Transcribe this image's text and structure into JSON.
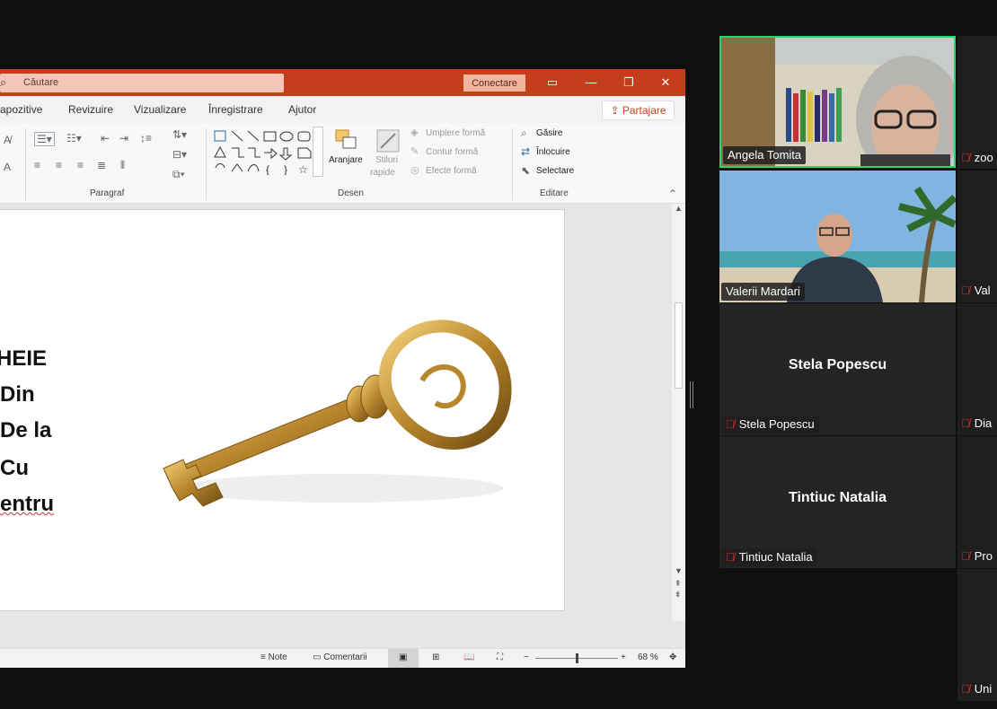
{
  "ppt": {
    "search_text": "Căutare",
    "connect_label": "Conectare",
    "tabs": [
      "apozitive",
      "Revizuire",
      "Vizualizare",
      "Înregistrare",
      "Ajutor"
    ],
    "share_label": "Partajare",
    "ribbon": {
      "group_paragraf": "Paragraf",
      "group_desen": "Desen",
      "group_editare": "Editare",
      "aranjare": "Aranjare",
      "stiluri": "Stiluri",
      "rapide": "rapide",
      "umplere_forma": "Umplere formă",
      "contur_forma": "Contur formă",
      "efecte_forma": "Efecte formă",
      "gasire": "Găsire",
      "inlocuire": "Înlocuire",
      "selectare": "Selectare"
    },
    "slide_lines": [
      "HEIE",
      "Din",
      "De la",
      "Cu",
      "entru"
    ],
    "status": {
      "note": "Note",
      "comentarii": "Comentarii",
      "zoom": "68 %",
      "zoom_fraction": 0.5
    }
  },
  "participants": [
    {
      "name": "Angela Tomita",
      "has_video": true,
      "speaking": true
    },
    {
      "name": "Valerii Mardari",
      "has_video": true,
      "speaking": false
    },
    {
      "name": "Stela Popescu",
      "has_video": false,
      "speaking": false
    },
    {
      "name": "Tintiuc Natalia",
      "has_video": false,
      "speaking": false
    }
  ],
  "side_participants": [
    "zoo",
    "Val",
    "Dia",
    "Pro",
    "Uni"
  ],
  "colors": {
    "ppt_accent": "#c43e1c",
    "speaking_border": "#23d96b",
    "mic_muted": "#e02828"
  }
}
